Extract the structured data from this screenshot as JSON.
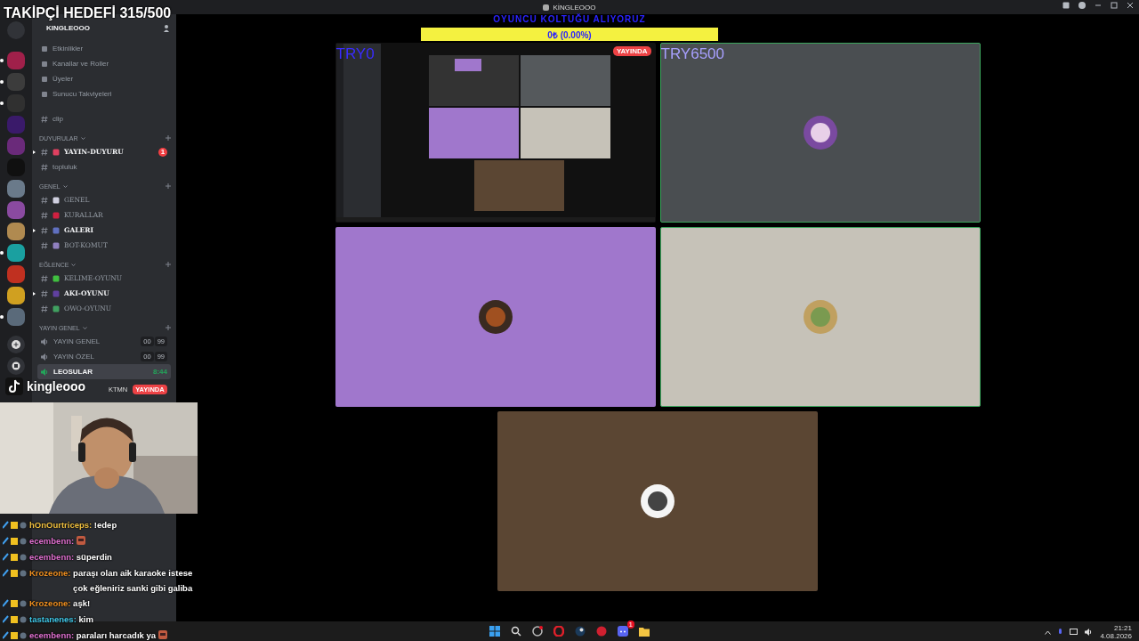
{
  "window": {
    "title": "KİNGLEOOO"
  },
  "overlay_title": "TAKİPÇİ HEDEFİ 315/500",
  "servers": [
    {
      "color": "#a0204a",
      "unread": true
    },
    {
      "color": "#3c3c3c",
      "unread": true
    },
    {
      "color": "#303030",
      "unread": true
    },
    {
      "color": "#3a1a6a",
      "unread": false
    },
    {
      "color": "#6a2a7a",
      "unread": false
    },
    {
      "color": "#101010",
      "unread": false
    },
    {
      "color": "#6a7a8a",
      "unread": false
    },
    {
      "color": "#8a4aa0",
      "unread": false
    },
    {
      "color": "#b08a50",
      "unread": false
    },
    {
      "color": "#1aa0a0",
      "unread": true
    },
    {
      "color": "#c03020",
      "unread": false
    },
    {
      "color": "#d0a020",
      "unread": false
    },
    {
      "color": "#5a6a7a",
      "unread": true
    }
  ],
  "server_name": "KINGLEOOO",
  "menu": [
    "Etkinlikler",
    "Kanallar ve Roller",
    "Üyeler",
    "Sunucu Takviyeleri"
  ],
  "top_channels": [
    {
      "name": "clip",
      "unread": false
    }
  ],
  "categories": [
    {
      "name": "DUYURULAR",
      "channels": [
        {
          "kind": "text",
          "name": "YAYIN-DUYURU",
          "deco": true,
          "color": "#e04060",
          "unread": true,
          "badge": "1"
        },
        {
          "kind": "text",
          "name": "topluluk",
          "deco": false,
          "unread": false
        }
      ]
    },
    {
      "name": "GENEL",
      "channels": [
        {
          "kind": "text",
          "name": "GENEL",
          "deco": true,
          "color": "#d0d0e0",
          "unread": false
        },
        {
          "kind": "text",
          "name": "KURALLAR",
          "deco": true,
          "color": "#d02040",
          "unread": false
        },
        {
          "kind": "text",
          "name": "GALERI",
          "deco": true,
          "color": "#6070c0",
          "unread": true
        },
        {
          "kind": "text",
          "name": "BOT-KOMUT",
          "deco": true,
          "color": "#9080c0",
          "unread": false
        }
      ]
    },
    {
      "name": "EĞLENCE",
      "channels": [
        {
          "kind": "text",
          "name": "KELIME-OYUNU",
          "deco": true,
          "color": "#40c040",
          "unread": false
        },
        {
          "kind": "text",
          "name": "AKI-OYUNU",
          "deco": true,
          "color": "#6040a0",
          "unread": true
        },
        {
          "kind": "text",
          "name": "OWO-OYUNU",
          "deco": true,
          "color": "#40a060",
          "unread": false
        }
      ]
    },
    {
      "name": "YAYIN GENEL",
      "channels": [
        {
          "kind": "voice",
          "name": "YAYIN GENEL",
          "counts": [
            "00",
            "99"
          ],
          "selected": false
        },
        {
          "kind": "voice",
          "name": "YAYIN ÖZEL",
          "counts": [
            "00",
            "99"
          ],
          "selected": false
        },
        {
          "kind": "voice",
          "name": "LEOSULAR",
          "time": "8:44",
          "selected": true
        }
      ]
    }
  ],
  "voice_user": {
    "tag": "KTMN",
    "badge": "YAYINDA"
  },
  "tiktok": "kingleooo",
  "goal": {
    "heading": "OYUNCU KOLTUĞU ALIYORUZ",
    "text": "0₺ (0.00%)"
  },
  "tiles": [
    {
      "kind": "screen",
      "label": "TRY0",
      "badge": "YAYINDA",
      "speaking": false
    },
    {
      "kind": "avatar",
      "label": "TRY6500",
      "color": "#4a4e51",
      "speaking": true
    },
    {
      "kind": "avatar",
      "color": "#a077cc",
      "speaking": false
    },
    {
      "kind": "avatar",
      "color": "#c6c2b8",
      "speaking": true
    },
    {
      "kind": "avatar",
      "color": "#5b4633",
      "speaking": false
    }
  ],
  "chat": [
    {
      "user": "hOnOurtriceps:",
      "color": "#f0c040",
      "text": "!edep",
      "emote": false
    },
    {
      "user": "ecembenn:",
      "color": "#e070d0",
      "emote": true
    },
    {
      "user": "ecembenn:",
      "color": "#e070d0",
      "text": "süperdin",
      "emote": false
    },
    {
      "user": "Krozeone:",
      "color": "#f09020",
      "text": "paraşı olan aik karaoke istese çok eğleniriz sanki gibi galiba",
      "emote": false
    },
    {
      "user": "Krozeone:",
      "color": "#f09020",
      "text": "aşk!",
      "emote": false
    },
    {
      "user": "tastanenes:",
      "color": "#40c8e8",
      "text": "kim",
      "emote": false
    },
    {
      "user": "ecembenn:",
      "color": "#e070d0",
      "text": "paraları harcadık ya",
      "emote": true
    }
  ],
  "clock": {
    "time": "21:21",
    "date": "4.08.2026"
  },
  "discord_badge": "1"
}
